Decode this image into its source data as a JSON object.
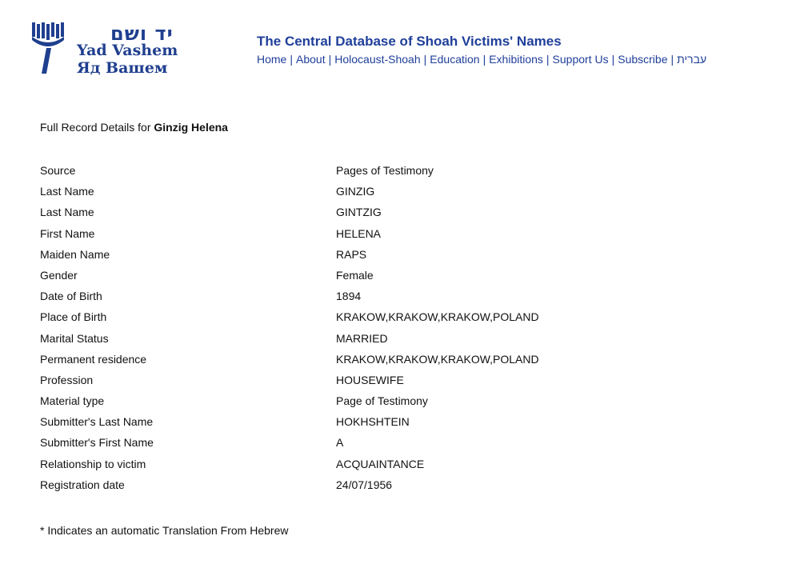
{
  "logo": {
    "hebrew": "יד ושם",
    "english": "Yad Vashem",
    "russian": "Яд Вашем"
  },
  "header": {
    "title": "The Central Database of Shoah Victims' Names",
    "nav": [
      {
        "label": "Home"
      },
      {
        "label": "About"
      },
      {
        "label": "Holocaust-Shoah"
      },
      {
        "label": "Education"
      },
      {
        "label": "Exhibitions"
      },
      {
        "label": "Support Us"
      },
      {
        "label": "Subscribe"
      },
      {
        "label": "עברית"
      }
    ]
  },
  "record": {
    "heading_prefix": "Full Record Details for",
    "heading_name": "Ginzig Helena",
    "fields": [
      {
        "label": "Source",
        "value": "Pages of Testimony"
      },
      {
        "label": "Last Name",
        "value": "GINZIG"
      },
      {
        "label": "Last Name",
        "value": "GINTZIG"
      },
      {
        "label": "First Name",
        "value": "HELENA"
      },
      {
        "label": "Maiden Name",
        "value": "RAPS"
      },
      {
        "label": "Gender",
        "value": "Female"
      },
      {
        "label": "Date of Birth",
        "value": "1894"
      },
      {
        "label": "Place of Birth",
        "value": "KRAKOW,KRAKOW,KRAKOW,POLAND"
      },
      {
        "label": "Marital Status",
        "value": "MARRIED"
      },
      {
        "label": "Permanent residence",
        "value": "KRAKOW,KRAKOW,KRAKOW,POLAND"
      },
      {
        "label": "Profession",
        "value": "HOUSEWIFE"
      },
      {
        "label": "Material type",
        "value": "Page of Testimony"
      },
      {
        "label": "Submitter's Last Name",
        "value": "HOKHSHTEIN"
      },
      {
        "label": "Submitter's First Name",
        "value": "A"
      },
      {
        "label": "Relationship to victim",
        "value": "ACQUAINTANCE"
      },
      {
        "label": "Registration date",
        "value": "24/07/1956"
      }
    ]
  },
  "footnote": "* Indicates an automatic Translation From Hebrew",
  "colors": {
    "brand_blue": "#1f3f9a",
    "text": "#111111",
    "background": "#ffffff"
  }
}
